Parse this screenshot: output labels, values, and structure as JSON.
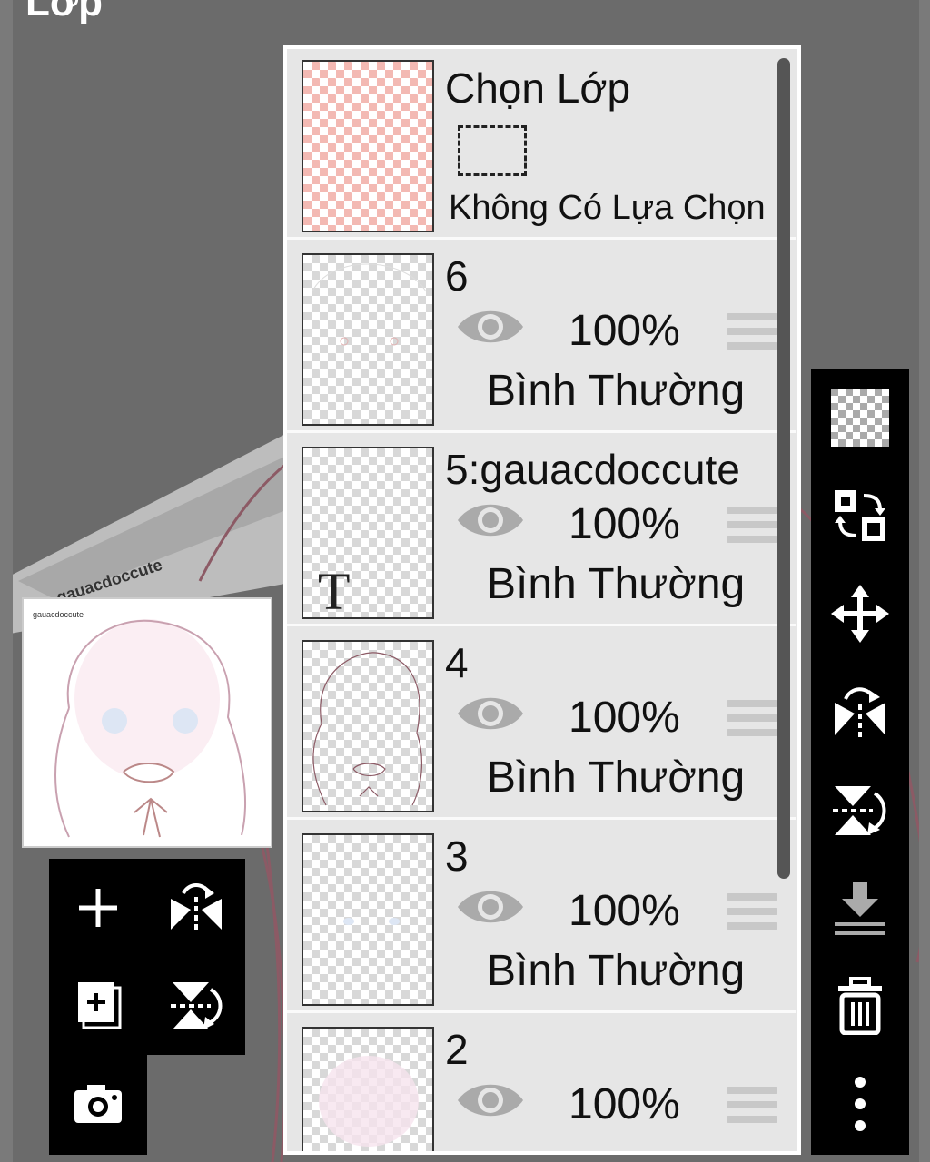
{
  "screen": {
    "title": "Lớp"
  },
  "selection_row": {
    "title": "Chọn Lớp",
    "status": "Không Có Lựa Chọn"
  },
  "layers": [
    {
      "name": "6",
      "opacity": "100%",
      "blend": "Bình Thường",
      "visible": true
    },
    {
      "name": "5:gauacdoccute",
      "opacity": "100%",
      "blend": "Bình Thường",
      "visible": true,
      "type": "text"
    },
    {
      "name": "4",
      "opacity": "100%",
      "blend": "Bình Thường",
      "visible": true
    },
    {
      "name": "3",
      "opacity": "100%",
      "blend": "Bình Thường",
      "visible": true
    },
    {
      "name": "2",
      "opacity": "100%",
      "visible": true
    }
  ],
  "canvas_watermark": "gauacdoccute",
  "left_toolbar": [
    "add-layer-icon",
    "flip-horizontal-icon",
    "duplicate-layer-icon",
    "flip-vertical-icon",
    "camera-icon"
  ],
  "right_toolbar": [
    "transparency-icon",
    "swap-layers-icon",
    "move-icon",
    "flip-horizontal-icon",
    "flip-vertical-icon",
    "merge-down-icon",
    "trash-icon",
    "more-icon"
  ],
  "colors": {
    "panel_bg": "#e6e6e6",
    "toolbar_bg": "#000000",
    "canvas_bg": "#6b6b6b",
    "selection_thumb": "#f3b9b3"
  }
}
